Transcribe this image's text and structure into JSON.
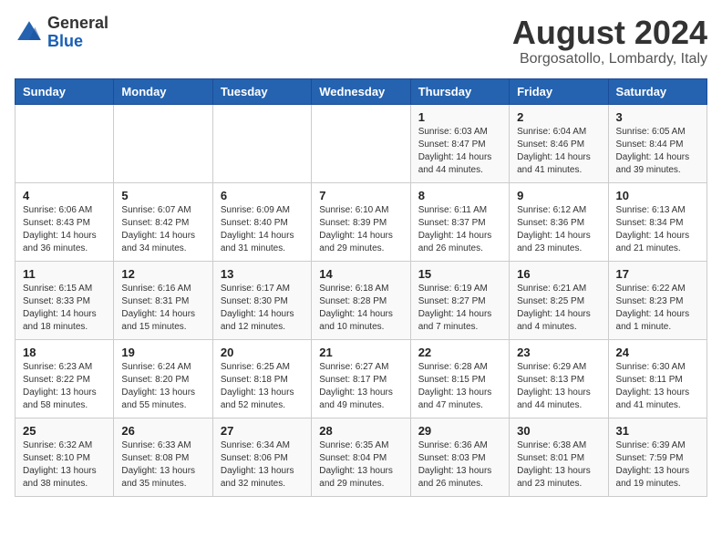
{
  "header": {
    "logo_line1": "General",
    "logo_line2": "Blue",
    "month_year": "August 2024",
    "location": "Borgosatollo, Lombardy, Italy"
  },
  "weekdays": [
    "Sunday",
    "Monday",
    "Tuesday",
    "Wednesday",
    "Thursday",
    "Friday",
    "Saturday"
  ],
  "weeks": [
    [
      {
        "day": "",
        "info": ""
      },
      {
        "day": "",
        "info": ""
      },
      {
        "day": "",
        "info": ""
      },
      {
        "day": "",
        "info": ""
      },
      {
        "day": "1",
        "info": "Sunrise: 6:03 AM\nSunset: 8:47 PM\nDaylight: 14 hours and 44 minutes."
      },
      {
        "day": "2",
        "info": "Sunrise: 6:04 AM\nSunset: 8:46 PM\nDaylight: 14 hours and 41 minutes."
      },
      {
        "day": "3",
        "info": "Sunrise: 6:05 AM\nSunset: 8:44 PM\nDaylight: 14 hours and 39 minutes."
      }
    ],
    [
      {
        "day": "4",
        "info": "Sunrise: 6:06 AM\nSunset: 8:43 PM\nDaylight: 14 hours and 36 minutes."
      },
      {
        "day": "5",
        "info": "Sunrise: 6:07 AM\nSunset: 8:42 PM\nDaylight: 14 hours and 34 minutes."
      },
      {
        "day": "6",
        "info": "Sunrise: 6:09 AM\nSunset: 8:40 PM\nDaylight: 14 hours and 31 minutes."
      },
      {
        "day": "7",
        "info": "Sunrise: 6:10 AM\nSunset: 8:39 PM\nDaylight: 14 hours and 29 minutes."
      },
      {
        "day": "8",
        "info": "Sunrise: 6:11 AM\nSunset: 8:37 PM\nDaylight: 14 hours and 26 minutes."
      },
      {
        "day": "9",
        "info": "Sunrise: 6:12 AM\nSunset: 8:36 PM\nDaylight: 14 hours and 23 minutes."
      },
      {
        "day": "10",
        "info": "Sunrise: 6:13 AM\nSunset: 8:34 PM\nDaylight: 14 hours and 21 minutes."
      }
    ],
    [
      {
        "day": "11",
        "info": "Sunrise: 6:15 AM\nSunset: 8:33 PM\nDaylight: 14 hours and 18 minutes."
      },
      {
        "day": "12",
        "info": "Sunrise: 6:16 AM\nSunset: 8:31 PM\nDaylight: 14 hours and 15 minutes."
      },
      {
        "day": "13",
        "info": "Sunrise: 6:17 AM\nSunset: 8:30 PM\nDaylight: 14 hours and 12 minutes."
      },
      {
        "day": "14",
        "info": "Sunrise: 6:18 AM\nSunset: 8:28 PM\nDaylight: 14 hours and 10 minutes."
      },
      {
        "day": "15",
        "info": "Sunrise: 6:19 AM\nSunset: 8:27 PM\nDaylight: 14 hours and 7 minutes."
      },
      {
        "day": "16",
        "info": "Sunrise: 6:21 AM\nSunset: 8:25 PM\nDaylight: 14 hours and 4 minutes."
      },
      {
        "day": "17",
        "info": "Sunrise: 6:22 AM\nSunset: 8:23 PM\nDaylight: 14 hours and 1 minute."
      }
    ],
    [
      {
        "day": "18",
        "info": "Sunrise: 6:23 AM\nSunset: 8:22 PM\nDaylight: 13 hours and 58 minutes."
      },
      {
        "day": "19",
        "info": "Sunrise: 6:24 AM\nSunset: 8:20 PM\nDaylight: 13 hours and 55 minutes."
      },
      {
        "day": "20",
        "info": "Sunrise: 6:25 AM\nSunset: 8:18 PM\nDaylight: 13 hours and 52 minutes."
      },
      {
        "day": "21",
        "info": "Sunrise: 6:27 AM\nSunset: 8:17 PM\nDaylight: 13 hours and 49 minutes."
      },
      {
        "day": "22",
        "info": "Sunrise: 6:28 AM\nSunset: 8:15 PM\nDaylight: 13 hours and 47 minutes."
      },
      {
        "day": "23",
        "info": "Sunrise: 6:29 AM\nSunset: 8:13 PM\nDaylight: 13 hours and 44 minutes."
      },
      {
        "day": "24",
        "info": "Sunrise: 6:30 AM\nSunset: 8:11 PM\nDaylight: 13 hours and 41 minutes."
      }
    ],
    [
      {
        "day": "25",
        "info": "Sunrise: 6:32 AM\nSunset: 8:10 PM\nDaylight: 13 hours and 38 minutes."
      },
      {
        "day": "26",
        "info": "Sunrise: 6:33 AM\nSunset: 8:08 PM\nDaylight: 13 hours and 35 minutes."
      },
      {
        "day": "27",
        "info": "Sunrise: 6:34 AM\nSunset: 8:06 PM\nDaylight: 13 hours and 32 minutes."
      },
      {
        "day": "28",
        "info": "Sunrise: 6:35 AM\nSunset: 8:04 PM\nDaylight: 13 hours and 29 minutes."
      },
      {
        "day": "29",
        "info": "Sunrise: 6:36 AM\nSunset: 8:03 PM\nDaylight: 13 hours and 26 minutes."
      },
      {
        "day": "30",
        "info": "Sunrise: 6:38 AM\nSunset: 8:01 PM\nDaylight: 13 hours and 23 minutes."
      },
      {
        "day": "31",
        "info": "Sunrise: 6:39 AM\nSunset: 7:59 PM\nDaylight: 13 hours and 19 minutes."
      }
    ]
  ]
}
